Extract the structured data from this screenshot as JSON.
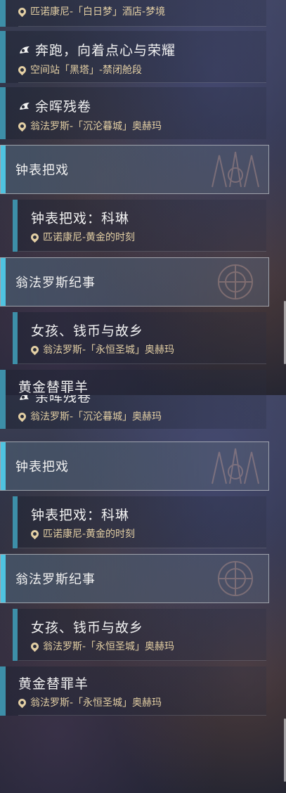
{
  "top_panel": {
    "entries": [
      {
        "title": "",
        "location": "匹诺康尼-「白日梦」酒店-梦境"
      },
      {
        "title": "奔跑，向着点心与荣耀",
        "location": "空间站「黑塔」-禁闭舱段",
        "has_icon": true
      },
      {
        "title": "余晖残卷",
        "location": "翁法罗斯-「沉沦暮城」奥赫玛",
        "has_icon": true
      }
    ],
    "header_clock": "钟表把戏",
    "sub_clock": {
      "title": "钟表把戏：科琳",
      "location": "匹诺康尼-黄金的时刻"
    },
    "header_amphoreus": "翁法罗斯纪事",
    "sub_amphoreus": {
      "title": "女孩、钱币与故乡",
      "location": "翁法罗斯-「永恒圣城」奥赫玛"
    },
    "partial_title": "黄金替罪羊"
  },
  "bottom_panel": {
    "partial_entry": {
      "title": "余晖残卷",
      "location": "翁法罗斯-「沉沦暮城」奥赫玛"
    },
    "header_clock": "钟表把戏",
    "sub_clock": {
      "title": "钟表把戏：科琳",
      "location": "匹诺康尼-黄金的时刻"
    },
    "header_amphoreus": "翁法罗斯纪事",
    "sub_amphoreus": {
      "title": "女孩、钱币与故乡",
      "location": "翁法罗斯-「永恒圣城」奥赫玛"
    },
    "last_entry": {
      "title": "黄金替罪羊",
      "location": "翁法罗斯-「永恒圣城」奥赫玛"
    }
  },
  "colors": {
    "accent_bar": "#3d8fa8",
    "header_bar": "#4fc3e0",
    "location_text": "#e3cfa4"
  }
}
